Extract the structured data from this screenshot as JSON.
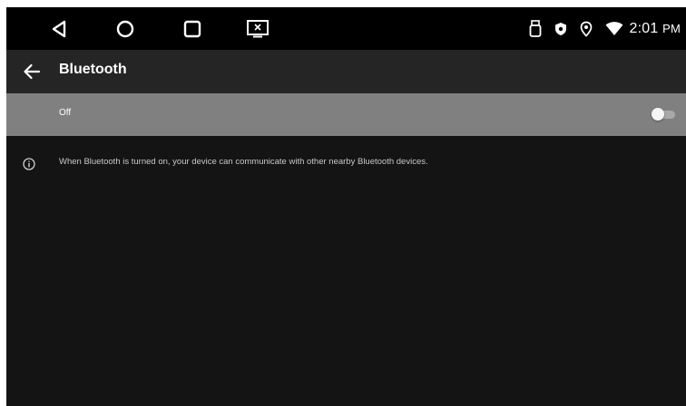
{
  "status_bar": {
    "time": "2:01",
    "ampm": "PM",
    "icons": [
      "usb-icon",
      "shield-icon",
      "location-icon",
      "wifi-icon"
    ]
  },
  "nav_bar": {
    "buttons": [
      "back-triangle-icon",
      "home-circle-icon",
      "recents-square-icon",
      "screenshot-icon"
    ]
  },
  "app_bar": {
    "title": "Bluetooth",
    "back_icon": "arrow-back-icon"
  },
  "bluetooth_toggle": {
    "label": "Off",
    "state": "off"
  },
  "info": {
    "icon": "info-icon",
    "text": "When Bluetooth is turned on, your device can communicate with other nearby Bluetooth devices."
  },
  "colors": {
    "background": "#141414",
    "status_bar": "#000000",
    "app_bar": "#252525",
    "toggle_row": "#808080",
    "text_primary": "#ffffff",
    "text_secondary": "#c9c9c9"
  }
}
